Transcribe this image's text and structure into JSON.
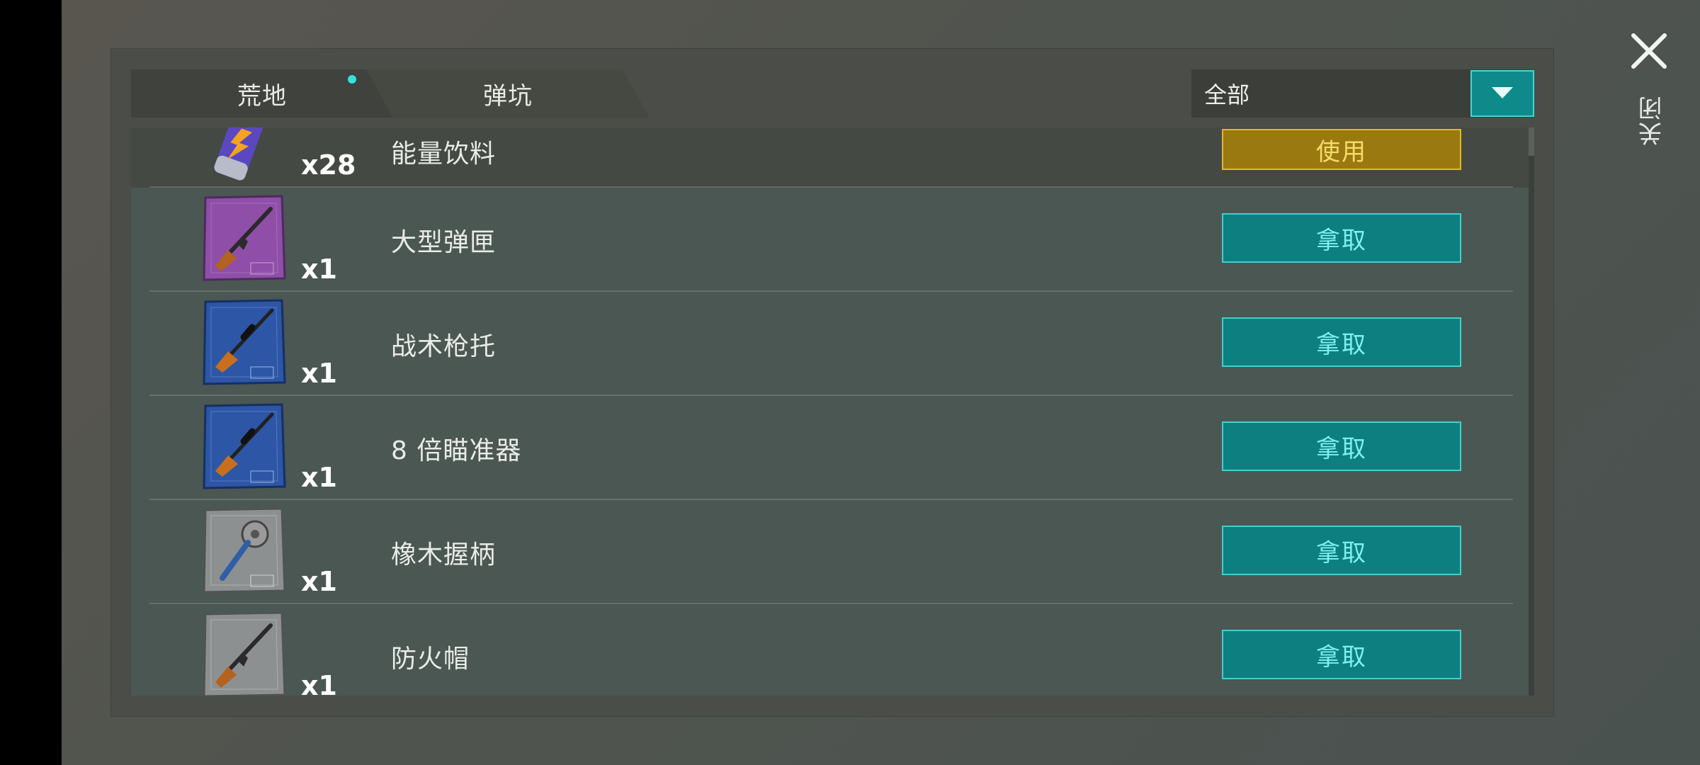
{
  "tabs": [
    {
      "label": "荒地",
      "active": true,
      "has_dot": true
    },
    {
      "label": "弹坑",
      "active": false
    }
  ],
  "filter": {
    "label": "全部",
    "icon": "dropdown-arrow-icon"
  },
  "close": {
    "label": "关闭",
    "icon": "close-icon"
  },
  "items": [
    {
      "name": "能量饮料",
      "qty": "x28",
      "action": "使用",
      "action_type": "use",
      "icon": "energy-drink-icon",
      "icon_color": "#6a55c8"
    },
    {
      "name": "大型弹匣",
      "qty": "x1",
      "action": "拿取",
      "action_type": "take",
      "icon": "rifle-blueprint-icon",
      "icon_color": "#8f4fa8"
    },
    {
      "name": "战术枪托",
      "qty": "x1",
      "action": "拿取",
      "action_type": "take",
      "icon": "sniper-blueprint-icon",
      "icon_color": "#2d56a6"
    },
    {
      "name": "8 倍瞄准器",
      "qty": "x1",
      "action": "拿取",
      "action_type": "take",
      "icon": "sniper-blueprint-icon",
      "icon_color": "#2d56a6"
    },
    {
      "name": "橡木握柄",
      "qty": "x1",
      "action": "拿取",
      "action_type": "take",
      "icon": "mace-blueprint-icon",
      "icon_color": "#8d9090"
    },
    {
      "name": "防火帽",
      "qty": "x1",
      "action": "拿取",
      "action_type": "take",
      "icon": "rifle-blueprint-icon",
      "icon_color": "#8d9090"
    }
  ]
}
